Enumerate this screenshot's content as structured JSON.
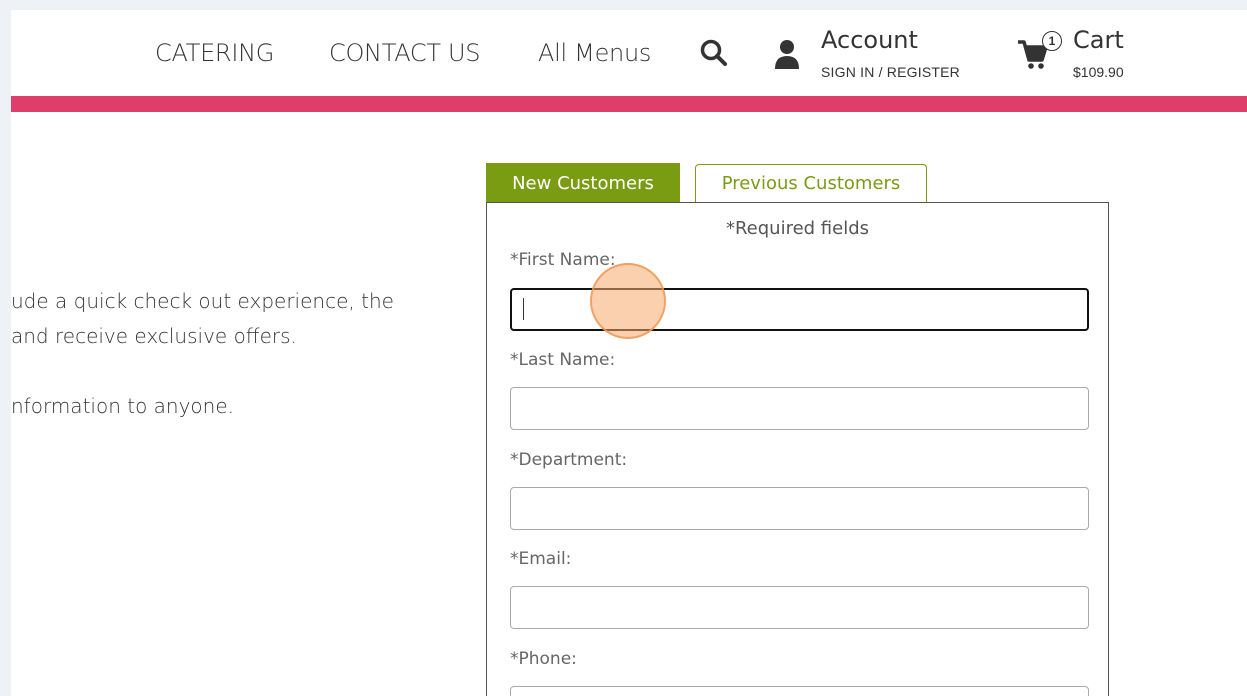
{
  "nav": {
    "links": [
      "CATERING",
      "CONTACT US",
      "All Menus"
    ],
    "account_title": "Account",
    "account_sub": "SIGN IN / REGISTER",
    "cart_title": "Cart",
    "cart_total": "$109.90",
    "cart_count": "1",
    "icons": [
      "search-icon",
      "user-icon",
      "cart-icon"
    ]
  },
  "intro": {
    "lines": [
      "ude a quick check out experience, the",
      "and receive exclusive offers.",
      "nformation to anyone."
    ]
  },
  "tabs": {
    "new": "New Customers",
    "previous": "Previous Customers"
  },
  "form": {
    "required_note": "*Required fields",
    "fields": [
      {
        "label": "*First Name:",
        "value": "",
        "focused": true
      },
      {
        "label": "*Last Name:",
        "value": ""
      },
      {
        "label": "*Department:",
        "value": ""
      },
      {
        "label": "*Email:",
        "value": ""
      },
      {
        "label": "*Phone:",
        "value": ""
      }
    ]
  },
  "colors": {
    "accent_bar": "#e03e6a",
    "tab_green": "#7a9c13"
  }
}
